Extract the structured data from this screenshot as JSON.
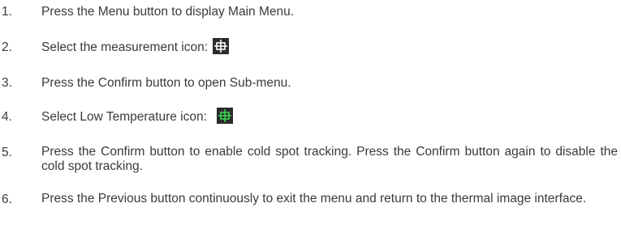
{
  "steps": [
    {
      "number": "1.",
      "text": "Press the Menu button to display Main Menu."
    },
    {
      "number": "2.",
      "text": "Select the measurement icon:",
      "icon": "measurement-crosshair-icon",
      "icon_bg": "#2b2b2b",
      "icon_fg": "#ffffff"
    },
    {
      "number": "3.",
      "text": "Press the Confirm button to open Sub-menu."
    },
    {
      "number": "4.",
      "text": "Select Low Temperature icon:",
      "icon": "low-temperature-crosshair-icon",
      "icon_bg": "#2b2b2b",
      "icon_fg": "#39d353"
    },
    {
      "number": "5.",
      "text": "Press the Confirm button to enable cold spot tracking. Press the Confirm button again to disable the cold spot tracking."
    },
    {
      "number": "6.",
      "text": "Press the Previous button continuously to exit the menu and return to the thermal image interface."
    }
  ]
}
